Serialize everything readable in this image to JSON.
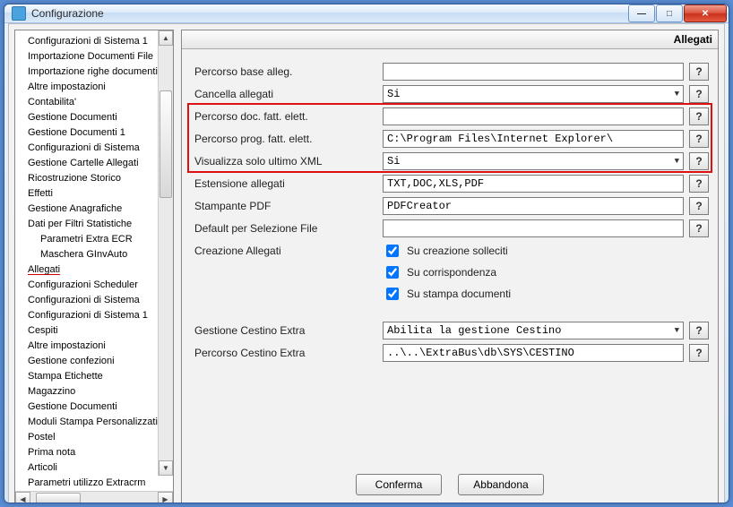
{
  "window": {
    "title": "Configurazione"
  },
  "tree": {
    "items": [
      {
        "label": "Configurazioni di Sistema 1",
        "indent": false
      },
      {
        "label": "Importazione Documenti File",
        "indent": false
      },
      {
        "label": "Importazione righe documenti",
        "indent": false
      },
      {
        "label": "Altre impostazioni",
        "indent": false
      },
      {
        "label": "Contabilita'",
        "indent": false
      },
      {
        "label": "Gestione Documenti",
        "indent": false
      },
      {
        "label": "Gestione Documenti 1",
        "indent": false
      },
      {
        "label": "Configurazioni di Sistema",
        "indent": false
      },
      {
        "label": "Gestione Cartelle Allegati",
        "indent": false
      },
      {
        "label": "Ricostruzione Storico",
        "indent": false
      },
      {
        "label": "Effetti",
        "indent": false
      },
      {
        "label": "Gestione Anagrafiche",
        "indent": false
      },
      {
        "label": "Dati per Filtri Statistiche",
        "indent": false
      },
      {
        "label": "Parametri Extra ECR",
        "indent": true
      },
      {
        "label": "Maschera GInvAuto",
        "indent": true
      },
      {
        "label": "Allegati",
        "indent": false,
        "selected": true
      },
      {
        "label": "Configurazioni Scheduler",
        "indent": false
      },
      {
        "label": "Configurazioni di Sistema",
        "indent": false
      },
      {
        "label": "Configurazioni di Sistema 1",
        "indent": false
      },
      {
        "label": "Cespiti",
        "indent": false
      },
      {
        "label": "Altre impostazioni",
        "indent": false
      },
      {
        "label": "Gestione confezioni",
        "indent": false
      },
      {
        "label": "Stampa Etichette",
        "indent": false
      },
      {
        "label": "Magazzino",
        "indent": false
      },
      {
        "label": "Gestione Documenti",
        "indent": false
      },
      {
        "label": "Moduli Stampa Personalizzati",
        "indent": false
      },
      {
        "label": "Postel",
        "indent": false
      },
      {
        "label": "Prima nota",
        "indent": false
      },
      {
        "label": "Articoli",
        "indent": false
      },
      {
        "label": "Parametri utilizzo Extracrm",
        "indent": false
      }
    ]
  },
  "main": {
    "header": "Allegati",
    "rows": {
      "percorso_base": {
        "label": "Percorso base alleg.",
        "value": "",
        "type": "text"
      },
      "cancella_allegati": {
        "label": "Cancella allegati",
        "value": "Si",
        "type": "combo"
      },
      "percorso_doc_fatt": {
        "label": "Percorso doc. fatt. elett.",
        "value": "",
        "type": "text"
      },
      "percorso_prog_fatt": {
        "label": "Percorso prog. fatt. elett.",
        "value": "C:\\Program Files\\Internet Explorer\\",
        "type": "text"
      },
      "visualizza_ultimo_xml": {
        "label": "Visualizza solo ultimo XML",
        "value": "Si",
        "type": "combo"
      },
      "estensione_allegati": {
        "label": "Estensione allegati",
        "value": "TXT,DOC,XLS,PDF",
        "type": "text"
      },
      "stampante_pdf": {
        "label": "Stampante PDF",
        "value": "PDFCreator",
        "type": "text"
      },
      "default_selezione": {
        "label": "Default per Selezione File",
        "value": "",
        "type": "text"
      },
      "creazione_allegati": {
        "label": "Creazione Allegati"
      },
      "gestione_cestino": {
        "label": "Gestione Cestino Extra",
        "value": "Abilita la gestione Cestino",
        "type": "combo"
      },
      "percorso_cestino": {
        "label": "Percorso Cestino Extra",
        "value": "..\\..\\ExtraBus\\db\\SYS\\CESTINO",
        "type": "text"
      }
    },
    "checkboxes": {
      "su_creazione": {
        "label": "Su creazione solleciti",
        "checked": true
      },
      "su_corrispondenza": {
        "label": "Su corrispondenza",
        "checked": true
      },
      "su_stampa": {
        "label": "Su stampa documenti",
        "checked": true
      }
    },
    "help_label": "?",
    "buttons": {
      "confirm": "Conferma",
      "abandon": "Abbandona"
    }
  }
}
